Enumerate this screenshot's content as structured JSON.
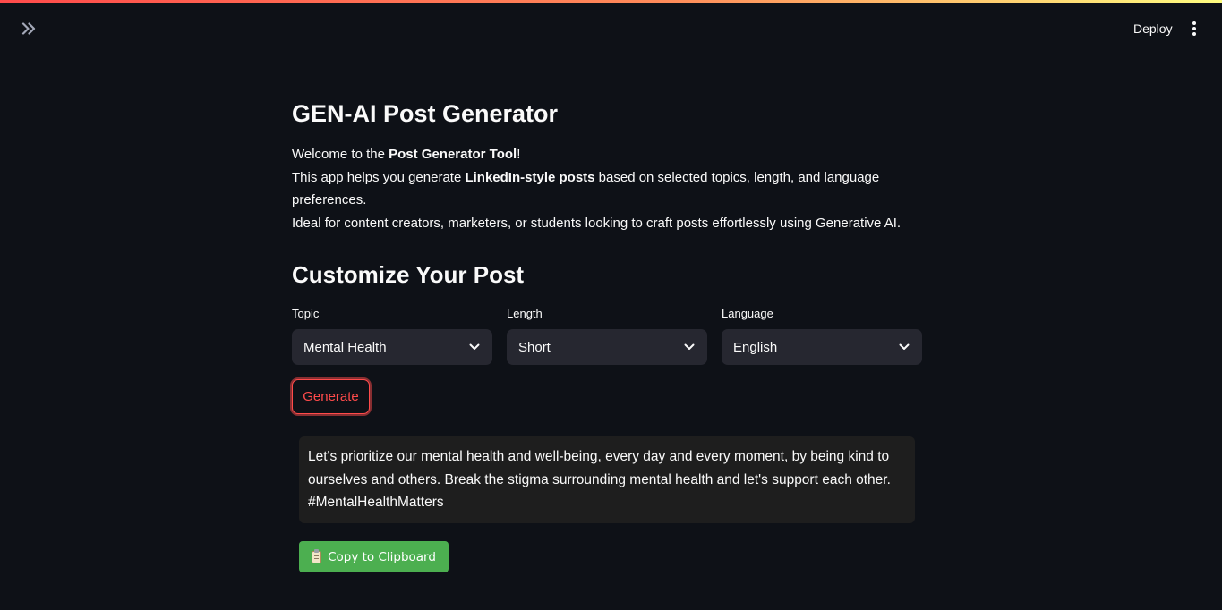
{
  "app": {
    "accent_color": "#ff4b4b",
    "background_color": "#0e1117"
  },
  "header": {
    "sidebar_toggle_icon": "chevron-double-right-icon",
    "deploy_label": "Deploy",
    "menu_icon": "vertical-ellipsis-icon"
  },
  "main": {
    "title": "GEN-AI Post Generator",
    "intro": {
      "line1_prefix": "Welcome to the ",
      "line1_bold": "Post Generator Tool",
      "line1_suffix": "!",
      "line2_prefix": "This app helps you generate ",
      "line2_bold": "LinkedIn-style posts",
      "line2_suffix": " based on selected topics, length, and language preferences.",
      "line3": "Ideal for content creators, marketers, or students looking to craft posts effortlessly using Generative AI."
    },
    "section_title": "Customize Your Post",
    "selects": {
      "topic": {
        "label": "Topic",
        "value": "Mental Health"
      },
      "length": {
        "label": "Length",
        "value": "Short"
      },
      "language": {
        "label": "Language",
        "value": "English"
      }
    },
    "generate_label": "Generate",
    "output_text": "Let's prioritize our mental health and well-being, every day and every moment, by being kind to ourselves and others. Break the stigma surrounding mental health and let's support each other. #MentalHealthMatters",
    "copy_button": {
      "icon": "clipboard-icon",
      "label": "Copy to Clipboard",
      "color": "#4caf50"
    }
  }
}
